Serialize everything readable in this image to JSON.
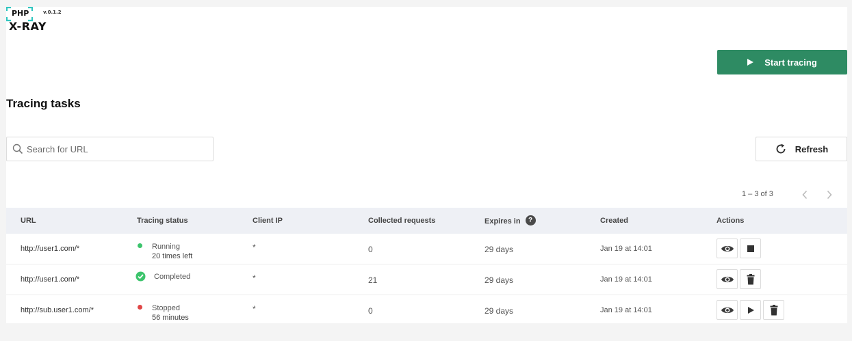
{
  "logo": {
    "php": "PHP",
    "xray": "X-RAY",
    "version": "v.0.1.2"
  },
  "header": {
    "start_button": "Start tracing",
    "section_title": "Tracing tasks"
  },
  "search": {
    "placeholder": "Search for URL",
    "value": ""
  },
  "refresh_button": "Refresh",
  "pagination": {
    "range": "1 – 3 of 3"
  },
  "table": {
    "headers": {
      "url": "URL",
      "status": "Tracing status",
      "client_ip": "Client IP",
      "collected": "Collected requests",
      "expires": "Expires in",
      "created": "Created",
      "actions": "Actions"
    },
    "rows": [
      {
        "url": "http://user1.com/*",
        "status": "Running",
        "status_sub": "20 times left",
        "status_color": "#3cc46c",
        "client_ip": "*",
        "collected": "0",
        "expires": "29 days",
        "created": "Jan 19 at 14:01",
        "actions": [
          "view",
          "stop"
        ]
      },
      {
        "url": "http://user1.com/*",
        "status": "Completed",
        "status_sub": "",
        "status_color": "#3cc46c",
        "client_ip": "*",
        "collected": "21",
        "expires": "29 days",
        "created": "Jan 19 at 14:01",
        "actions": [
          "view",
          "delete"
        ]
      },
      {
        "url": "http://sub.user1.com/*",
        "status": "Stopped",
        "status_sub": "56 minutes",
        "status_color": "#e04646",
        "client_ip": "*",
        "collected": "0",
        "expires": "29 days",
        "created": "Jan 19 at 14:01",
        "actions": [
          "view",
          "play",
          "delete"
        ]
      }
    ]
  },
  "colors": {
    "accent": "#2e8b63",
    "header_bg": "#eef0f5",
    "logo_bracket": "#31c6c0"
  }
}
